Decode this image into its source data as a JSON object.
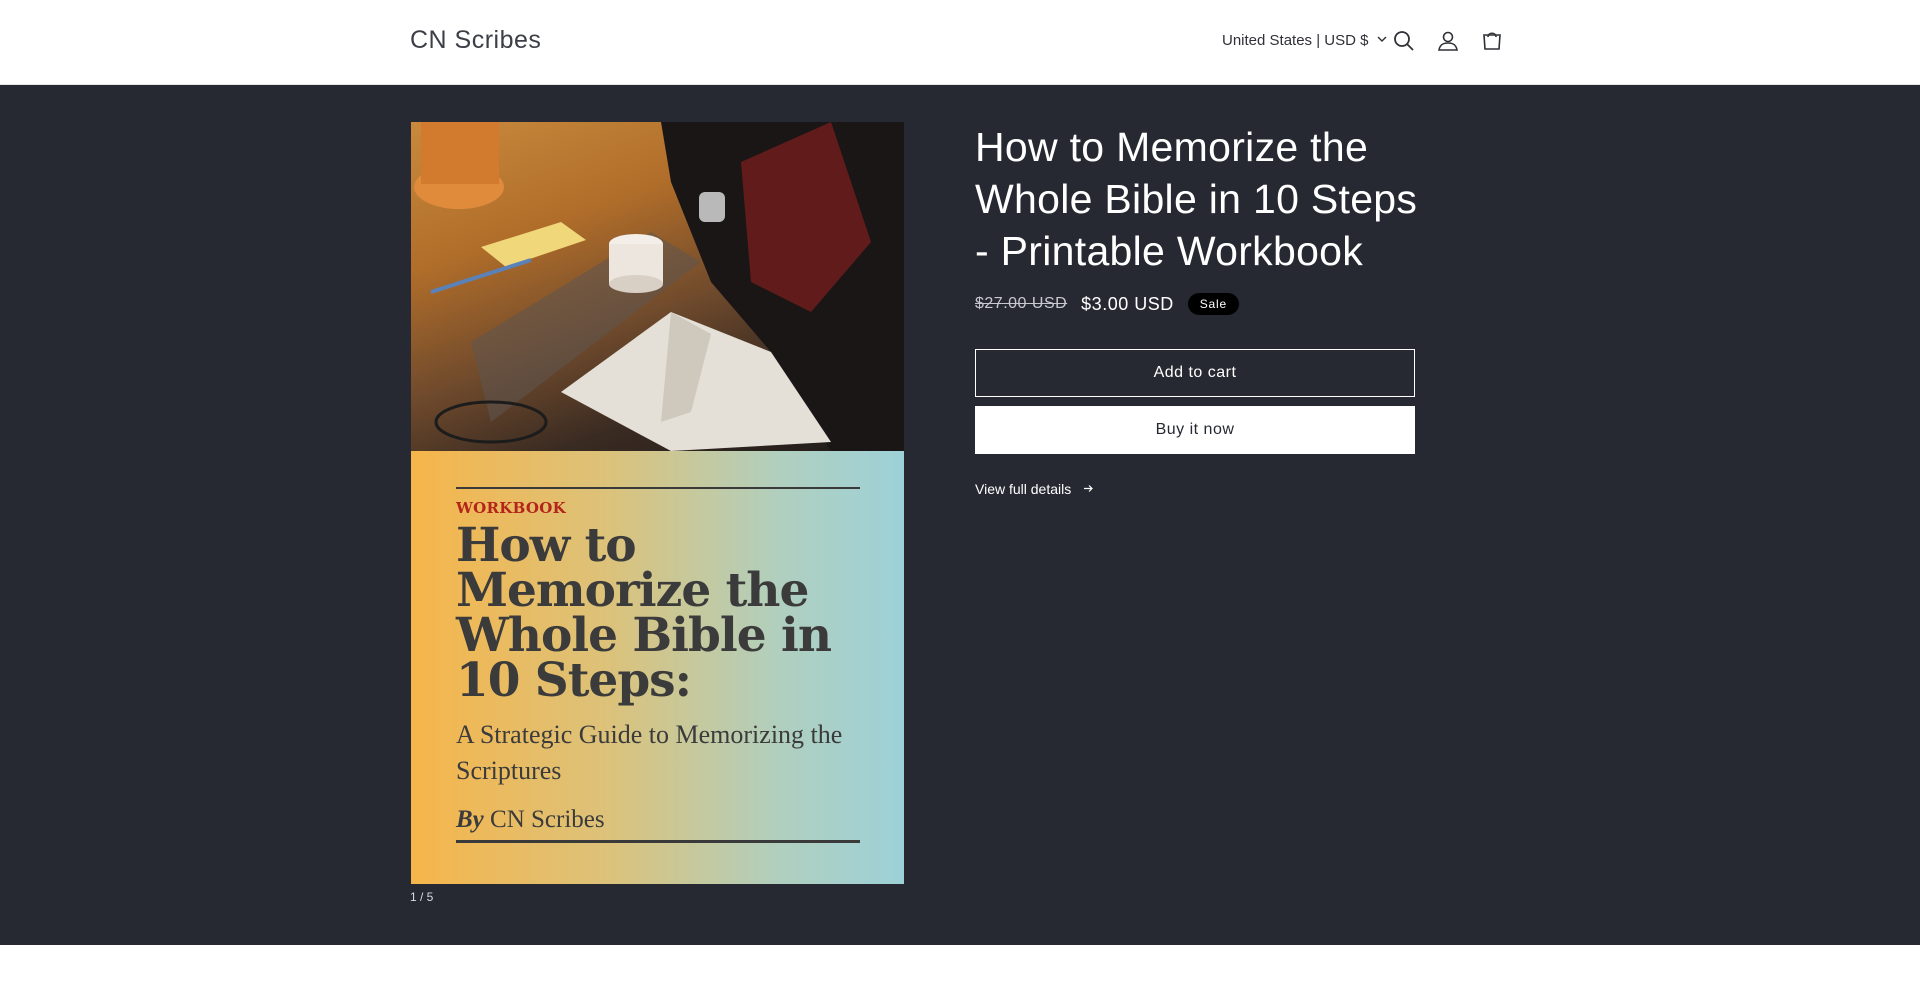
{
  "header": {
    "logo": "CN Scribes",
    "locale": "United States | USD $",
    "icons": [
      "search-icon",
      "account-icon",
      "cart-icon"
    ]
  },
  "product": {
    "title": "How to Memorize the Whole Bible in 10 Steps - Printable Workbook",
    "price_regular": "$27.00 USD",
    "price_sale": "$3.00 USD",
    "badge": "Sale",
    "add_to_cart": "Add to cart",
    "buy_now": "Buy it now",
    "view_details": "View full details"
  },
  "media": {
    "cover_kicker": "WORKBOOK",
    "cover_title": "How to Memorize the Whole Bible in 10 Steps:",
    "cover_subtitle": "A Strategic Guide to Memorizing the Scriptures",
    "cover_author_prefix": "By",
    "cover_author": "CN Scribes",
    "counter": "1 / 5"
  },
  "colors": {
    "header_bg": "#ffffff",
    "main_bg": "#262932",
    "text_light": "#ffffff",
    "badge_bg": "#000000",
    "cover_accent": "#b3241b"
  }
}
